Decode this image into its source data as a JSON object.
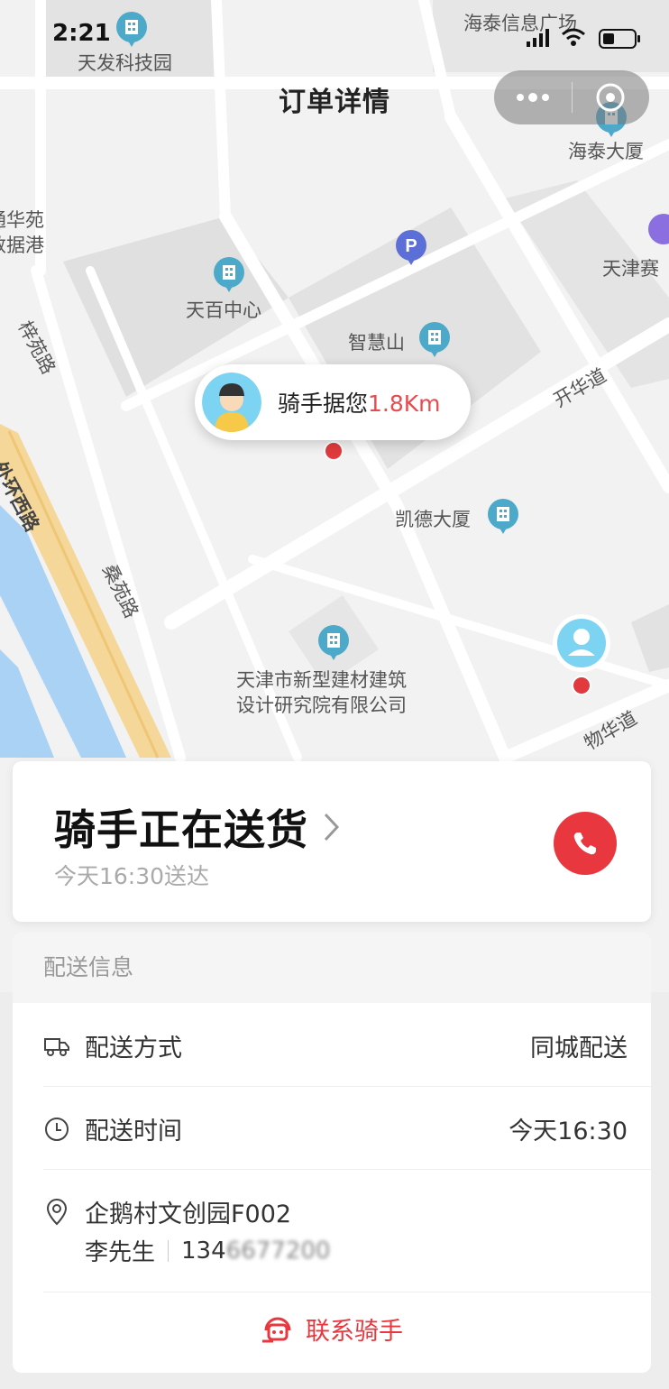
{
  "status_bar": {
    "time": "2:21"
  },
  "nav": {
    "title": "订单详情"
  },
  "map": {
    "labels": {
      "tianfa": "天发科技园",
      "haitai_info": "海泰信息广场",
      "haitai_building": "海泰大厦",
      "tianbai": "天百中心",
      "zhihuishan": "智慧山",
      "kaihua_road": "开华道",
      "kaide": "凯德大厦",
      "ziyuan_road": "梓苑路",
      "outer_ring": "外环西路",
      "sangyuan_road": "桑苑路",
      "jiancai_1": "天津市新型建材建筑",
      "jiancai_2": "设计研究院有限公司",
      "wuhua_road": "物华道",
      "tianjin_sai": "天津赛",
      "huayuan_1": "通华苑",
      "huayuan_2": "数据港"
    },
    "rider_bubble": {
      "prefix": "骑手据您",
      "distance": "1.8Km"
    }
  },
  "delivery_status": {
    "title": "骑手正在送货",
    "subtitle": "今天16:30送达"
  },
  "delivery_info": {
    "header": "配送信息",
    "method_label": "配送方式",
    "method_value": "同城配送",
    "time_label": "配送时间",
    "time_value": "今天16:30",
    "address": "企鹅村文创园F002",
    "contact_name": "李先生",
    "contact_phone": "134",
    "contact_phone_masked": "6677200",
    "contact_rider": "联系骑手"
  },
  "colors": {
    "accent": "#e8373e",
    "distance": "#e84a4f"
  },
  "icons": [
    "truck-icon",
    "clock-icon",
    "location-pin-icon",
    "headset-icon",
    "phone-icon",
    "chevron-right-icon"
  ]
}
